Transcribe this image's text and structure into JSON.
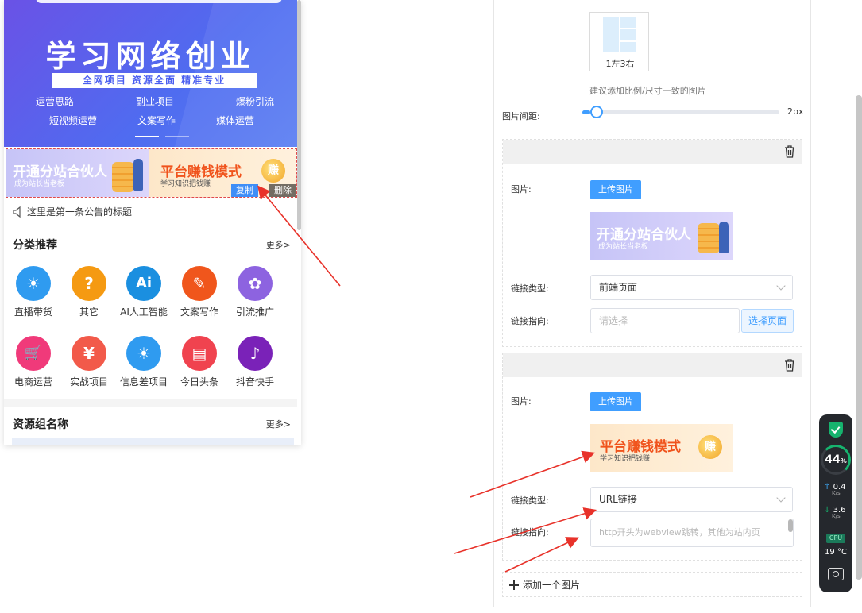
{
  "preview": {
    "hero": {
      "title": "学习网络创业",
      "subtitle": "全网项目  资源全面  精准专业",
      "row1": [
        "运营思路",
        "副业项目",
        "爆粉引流"
      ],
      "row2": [
        "短视频运营",
        "文案写作",
        "媒体运营"
      ]
    },
    "banner1": {
      "title": "开通分站合伙人",
      "sub": "成为站长当老板"
    },
    "banner2": {
      "title": "平台赚钱模式",
      "sub": "学习知识把钱赚",
      "coin": "赚"
    },
    "copy_label": "复制",
    "delete_label": "删除",
    "notice": "这里是第一条公告的标题",
    "category": {
      "title": "分类推荐",
      "more": "更多>",
      "items": [
        {
          "label": "直播带货",
          "color": "#2f9bf0",
          "glyph": "☀"
        },
        {
          "label": "其它",
          "color": "#f59a12",
          "glyph": "?"
        },
        {
          "label": "AI人工智能",
          "color": "#1a8fe0",
          "glyph": "Ai"
        },
        {
          "label": "文案写作",
          "color": "#f0561c",
          "glyph": "✎"
        },
        {
          "label": "引流推广",
          "color": "#8d63e0",
          "glyph": "✿"
        },
        {
          "label": "电商运营",
          "color": "#f03a7a",
          "glyph": "🛒"
        },
        {
          "label": "实战项目",
          "color": "#f25a4a",
          "glyph": "¥"
        },
        {
          "label": "信息差项目",
          "color": "#2f9bf0",
          "glyph": "☀"
        },
        {
          "label": "今日头条",
          "color": "#f0434f",
          "glyph": "▤"
        },
        {
          "label": "抖音快手",
          "color": "#7a22b8",
          "glyph": "♪"
        }
      ]
    },
    "resource": {
      "title": "资源组名称",
      "more": "更多>"
    }
  },
  "editor": {
    "layout_label": "1左3右",
    "hint": "建议添加比例/尺寸一致的图片",
    "spacing_label": "图片间距:",
    "spacing_value": "2px",
    "spacing_fraction": 0.04,
    "image_label": "图片:",
    "upload_label": "上传图片",
    "link_type_label": "链接类型:",
    "link_target_label": "链接指向:",
    "item1": {
      "link_type": "前端页面",
      "link_target_placeholder": "请选择",
      "pick_label": "选择页面"
    },
    "item2": {
      "link_type": "URL链接",
      "link_target_placeholder": "http开头为webview跳转，其他为站内页"
    },
    "add_label": "添加一个图片"
  },
  "monitor": {
    "percent": "44",
    "percent_unit": "%",
    "up": "0.4",
    "down": "3.6",
    "unit": "K/s",
    "cpu": "CPU",
    "temp": "19 °C"
  },
  "colors": {
    "accent": "#409eff",
    "arrow": "#e8322a"
  }
}
